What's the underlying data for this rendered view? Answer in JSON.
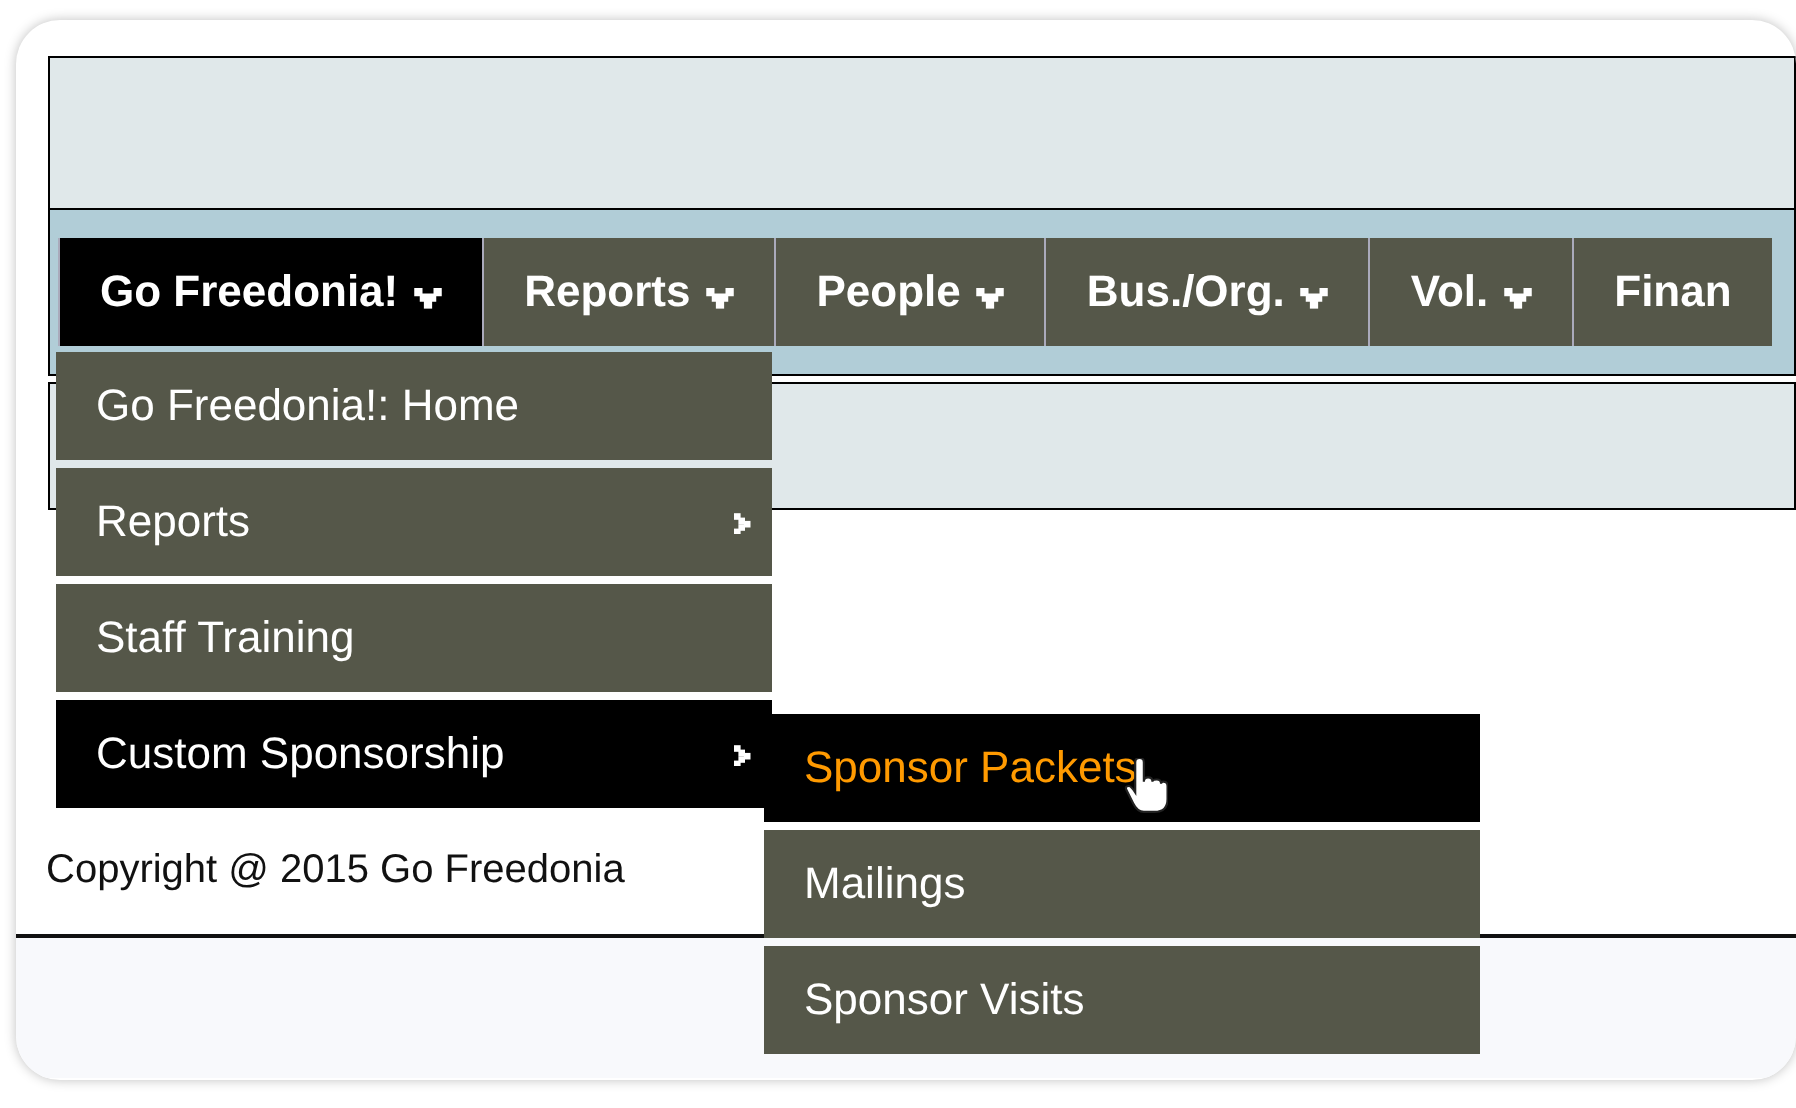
{
  "nav": [
    {
      "label": "Go Freedonia!",
      "selected": true,
      "caret": true
    },
    {
      "label": "Reports",
      "selected": false,
      "caret": true
    },
    {
      "label": "People",
      "selected": false,
      "caret": true
    },
    {
      "label": "Bus./Org.",
      "selected": false,
      "caret": true
    },
    {
      "label": "Vol.",
      "selected": false,
      "caret": true
    },
    {
      "label": "Finan",
      "selected": false,
      "caret": false
    }
  ],
  "menu": [
    {
      "label": "Go Freedonia!: Home",
      "selected": false,
      "submenu": false
    },
    {
      "label": "Reports",
      "selected": false,
      "submenu": true
    },
    {
      "label": "Staff Training",
      "selected": false,
      "submenu": false
    },
    {
      "label": "Custom Sponsorship",
      "selected": true,
      "submenu": true
    }
  ],
  "submenu": [
    {
      "label": "Sponsor Packets",
      "selected": true
    },
    {
      "label": "Mailings",
      "selected": false
    },
    {
      "label": "Sponsor Visits",
      "selected": false
    }
  ],
  "footer": {
    "copyright": "Copyright @ 2015 Go Freedonia"
  }
}
